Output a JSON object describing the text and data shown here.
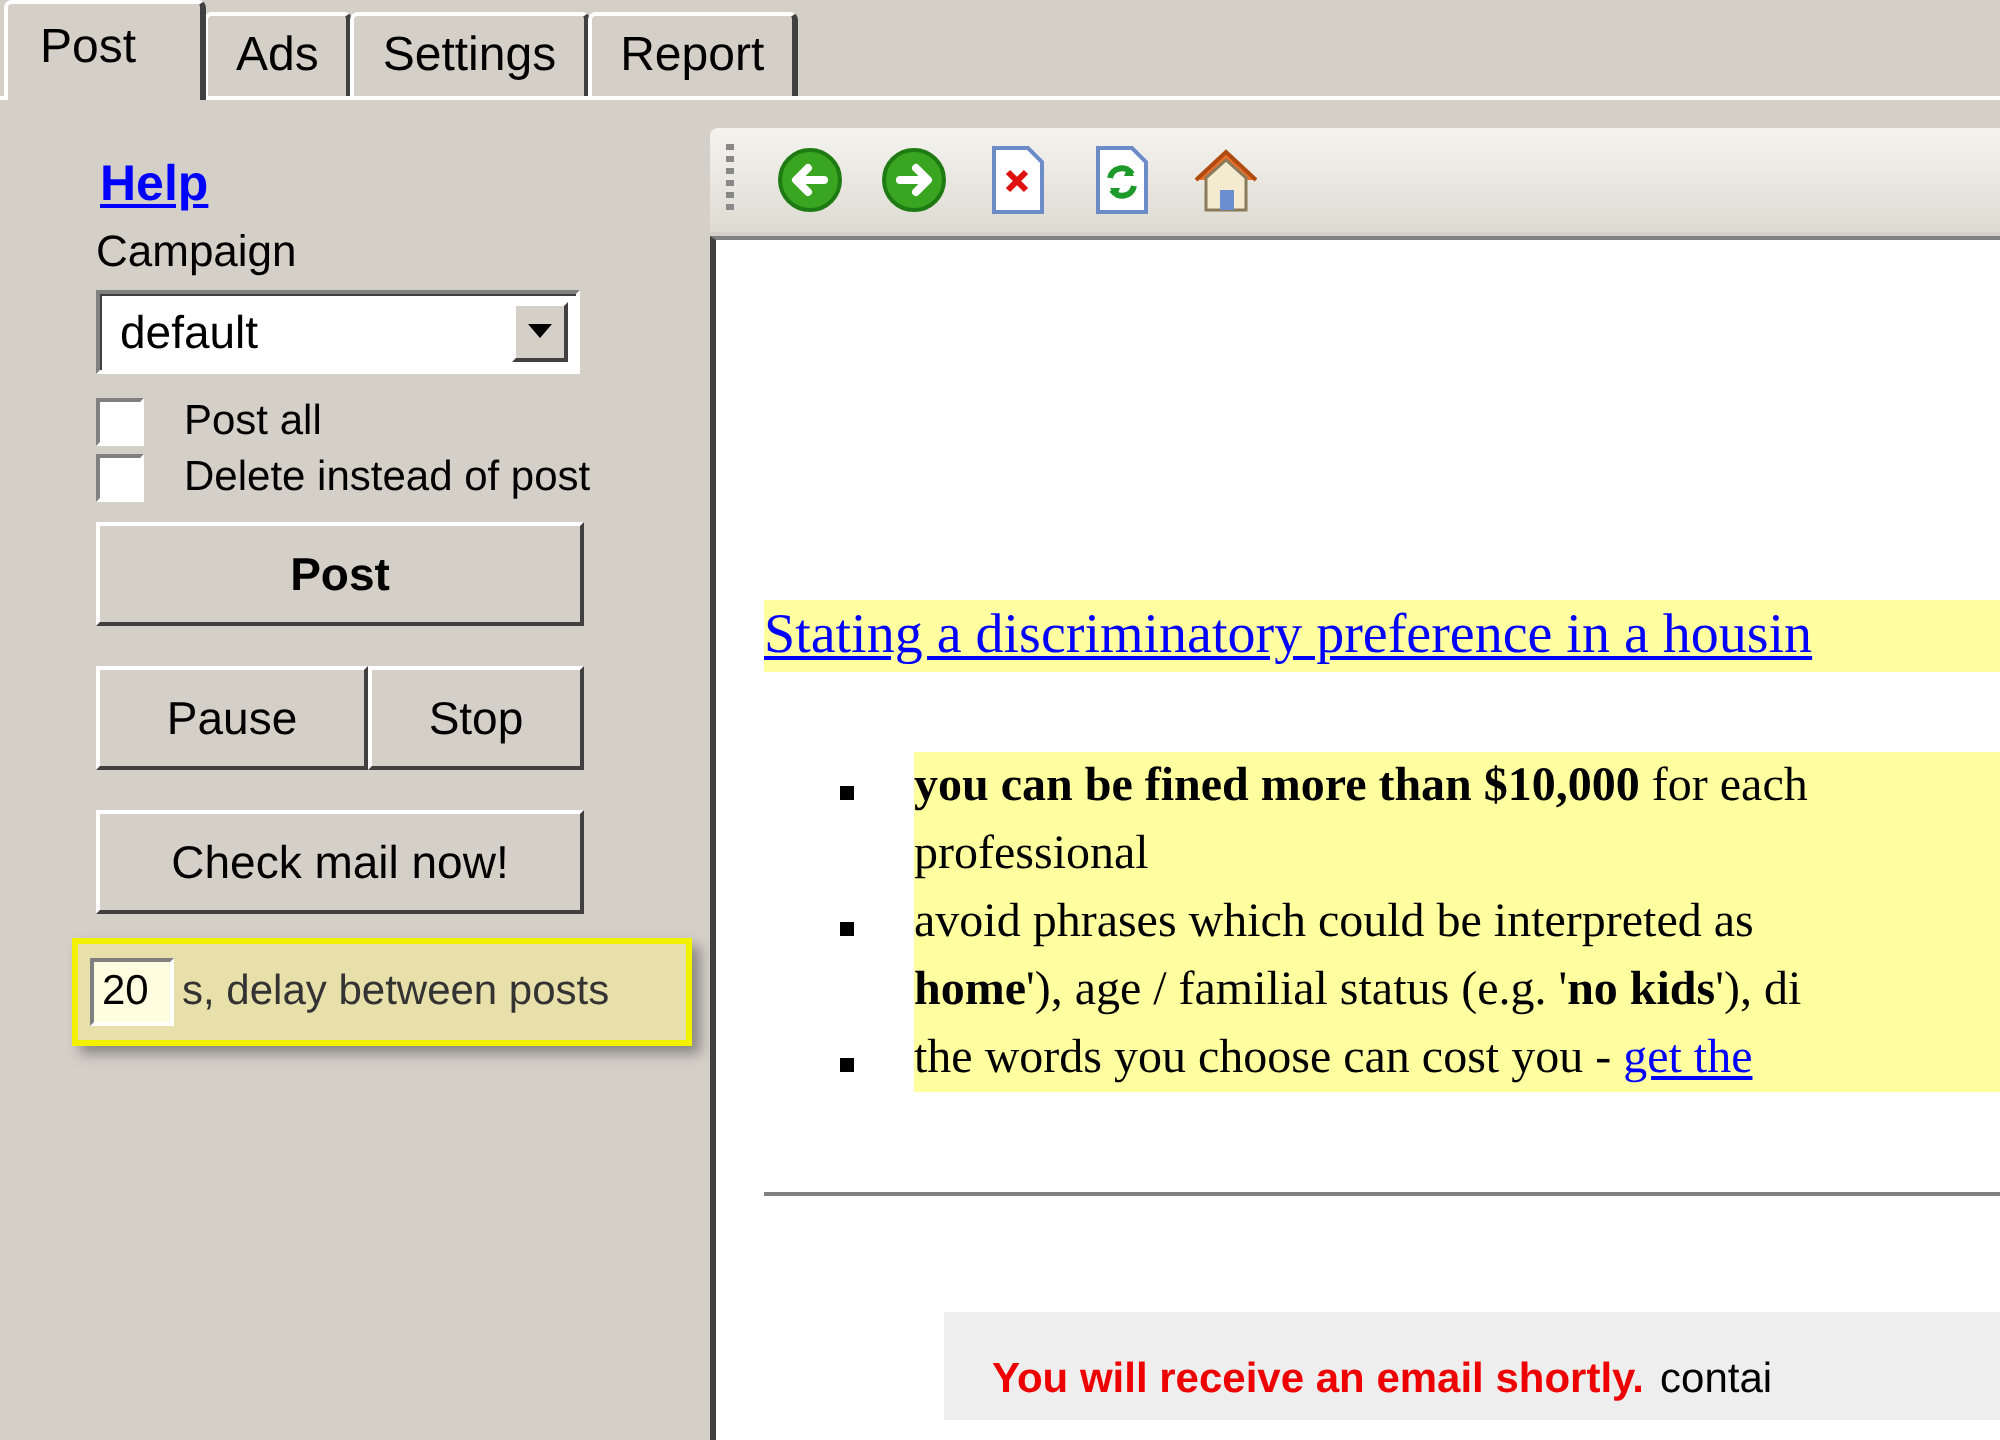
{
  "tabs": [
    {
      "label": "Post",
      "selected": true
    },
    {
      "label": "Ads",
      "selected": false
    },
    {
      "label": "Settings",
      "selected": false
    },
    {
      "label": "Report",
      "selected": false
    }
  ],
  "sidebar": {
    "help_link": "Help",
    "campaign_label": "Campaign",
    "campaign_value": "default",
    "checkboxes": [
      {
        "label": "Post all",
        "checked": false
      },
      {
        "label": "Delete instead of post",
        "checked": false
      }
    ],
    "post_button": "Post",
    "pause_button": "Pause",
    "stop_button": "Stop",
    "check_mail_button": "Check mail now!",
    "delay": {
      "value": "20",
      "label": "s, delay between posts"
    }
  },
  "browser": {
    "heading_link": "Stating a discriminatory preference in a housin",
    "bullets": [
      {
        "lines": [
          "**you can be fined more than $10,000** for each",
          "professional"
        ]
      },
      {
        "lines": [
          "avoid phrases which could be interpreted as",
          "**home**'), age / familial status (e.g. '**no kids**'), di"
        ]
      },
      {
        "lines": [
          "the words you choose can cost you - "
        ],
        "link": "get the"
      }
    ],
    "notice": {
      "alert": "You will receive an email shortly.",
      "text": "contai"
    }
  }
}
